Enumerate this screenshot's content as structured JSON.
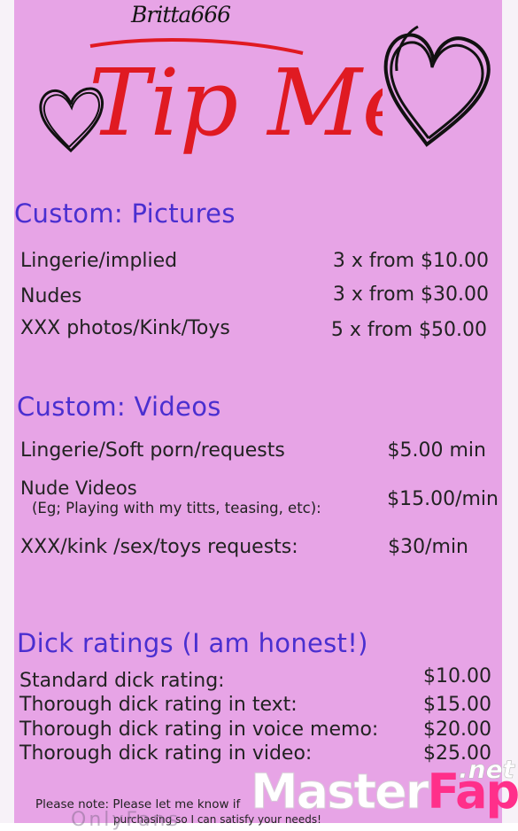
{
  "header": {
    "username": "Britta666",
    "title": "Tip Menu"
  },
  "sections": [
    {
      "title": "Custom: Pictures",
      "items": [
        {
          "label": "Lingerie/implied",
          "price": "3 x from $10.00"
        },
        {
          "label": "Nudes",
          "price": "3 x from $30.00"
        },
        {
          "label": "XXX photos/Kink/Toys",
          "price": "5 x from $50.00"
        }
      ]
    },
    {
      "title": "Custom: Videos",
      "items": [
        {
          "label": "Lingerie/Soft porn/requests",
          "price": "$5.00 min"
        },
        {
          "label": "Nude Videos",
          "sublabel": "(Eg; Playing with my titts, teasing, etc):",
          "price": "$15.00/min"
        },
        {
          "label": "XXX/kink /sex/toys requests:",
          "price": "$30/min"
        }
      ]
    },
    {
      "title": "Dick ratings (I am honest!)",
      "items": [
        {
          "label": "Standard dick rating:",
          "price": "$10.00"
        },
        {
          "label": "Thorough dick rating in text:",
          "price": "$15.00"
        },
        {
          "label": "Thorough dick rating in voice memo:",
          "price": "$20.00"
        },
        {
          "label": "Thorough dick rating in video:",
          "price": "$25.00"
        }
      ]
    }
  ],
  "footer": {
    "note_line1": "Please note: Please let me know if",
    "note_line2": "purchasing so I can satisfy your needs!",
    "ghost": "OnlyFans"
  },
  "watermark": {
    "master": "Master",
    "fap": "Fap",
    "net": ".net"
  },
  "colors": {
    "background": "#e7a4e6",
    "section_title": "#4a2fd0",
    "title_red": "#e01a22",
    "watermark_pink": "#ff2f8a"
  },
  "icons": [
    "heart-outline-icon",
    "heart-outline-icon"
  ]
}
